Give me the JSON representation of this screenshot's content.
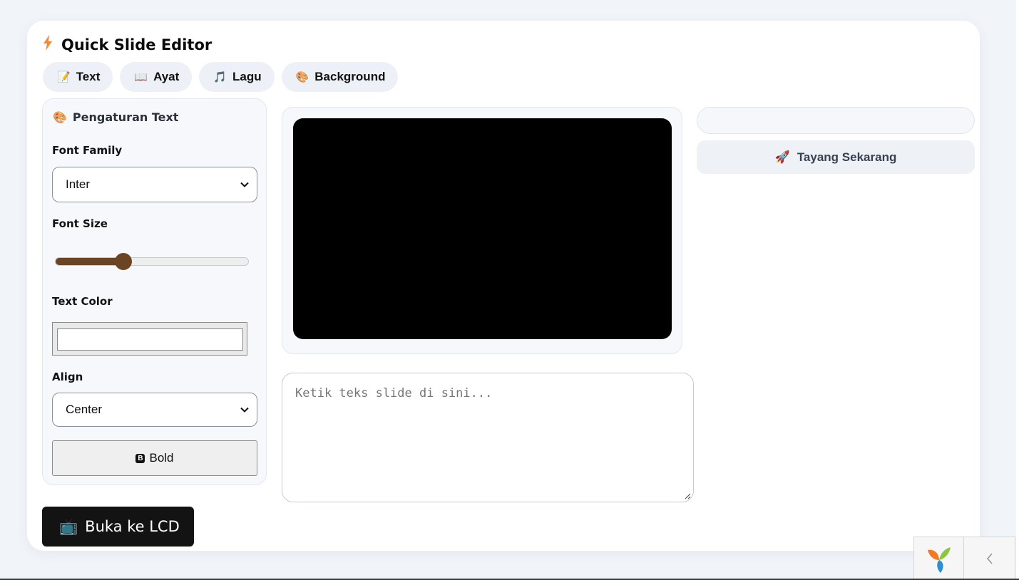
{
  "header": {
    "icon": "lightning-icon",
    "title": "Quick Slide Editor"
  },
  "tabs": [
    {
      "icon": "memo-icon",
      "glyph": "📝",
      "label": "Text"
    },
    {
      "icon": "open-book-icon",
      "glyph": "📖",
      "label": "Ayat"
    },
    {
      "icon": "music-note-icon",
      "glyph": "🎵",
      "label": "Lagu"
    },
    {
      "icon": "palette-icon",
      "glyph": "🎨",
      "label": "Background"
    }
  ],
  "settings": {
    "icon": "palette-icon",
    "title": "Pengaturan Text",
    "font_family": {
      "label": "Font Family",
      "value": "Inter"
    },
    "font_size": {
      "label": "Font Size",
      "fraction": 0.35
    },
    "text_color": {
      "label": "Text Color",
      "value": ""
    },
    "align": {
      "label": "Align",
      "value": "Center"
    },
    "bold_button": {
      "icon": "bold-b-icon",
      "badge": "B",
      "label": "Bold"
    }
  },
  "preview": {
    "background": "#000000"
  },
  "editor": {
    "placeholder": "Ketik teks slide di sini..."
  },
  "right_panel": {
    "input_value": "",
    "tayang_button": {
      "icon": "rocket-icon",
      "glyph": "🚀",
      "label": "Tayang Sekarang"
    }
  },
  "lcd_button": {
    "icon": "tv-icon",
    "glyph": "📺",
    "label": "Buka ke LCD"
  },
  "debug_toolbar": {
    "logo": "yii-logo-icon",
    "toggle": "chevron-left-icon"
  },
  "colors": {
    "accent": "#6b4423",
    "dark_button": "#131313",
    "bolt": "#f08a3c"
  }
}
